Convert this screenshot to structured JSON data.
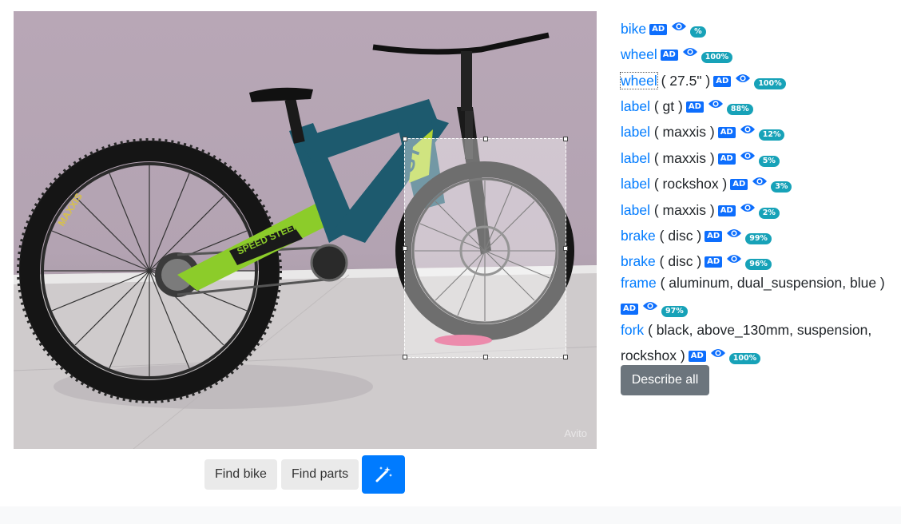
{
  "photo": {
    "watermark": "Avito",
    "frame_decal": "GT",
    "swingarm_decal": "SPEED STEEP",
    "tire_brand": "MAXXIS"
  },
  "actions": {
    "find_bike": "Find bike",
    "find_parts": "Find parts",
    "magic_icon": "magic-wand-icon"
  },
  "results": [
    {
      "label": "bike",
      "attrs": "",
      "pct": "%"
    },
    {
      "label": "wheel",
      "attrs": "",
      "pct": "100%"
    },
    {
      "label": "wheel",
      "attrs": "( 27.5\" )",
      "pct": "100%"
    },
    {
      "label": "label",
      "attrs": "( gt )",
      "pct": "88%"
    },
    {
      "label": "label",
      "attrs": "( maxxis )",
      "pct": "12%"
    },
    {
      "label": "label",
      "attrs": "( maxxis )",
      "pct": "5%"
    },
    {
      "label": "label",
      "attrs": "( rockshox )",
      "pct": "3%"
    },
    {
      "label": "label",
      "attrs": "( maxxis )",
      "pct": "2%"
    },
    {
      "label": "brake",
      "attrs": "( disc )",
      "pct": "99%"
    },
    {
      "label": "brake",
      "attrs": "( disc )",
      "pct": "96%"
    },
    {
      "label": "frame",
      "attrs": "( aluminum, dual_suspension, blue )",
      "pct": "97%"
    },
    {
      "label": "fork",
      "attrs": "( black, above_130mm, suspension,",
      "attrs2": "rockshox )",
      "pct": "100%"
    }
  ],
  "badge_text": "AD",
  "describe_all": "Describe all",
  "colors": {
    "link": "#007bff",
    "percent_badge": "#17a2b8",
    "primary": "#007bff",
    "secondary": "#6c757d",
    "frame_teal": "#1d5a6e",
    "accent_green": "#8ccc2a"
  }
}
